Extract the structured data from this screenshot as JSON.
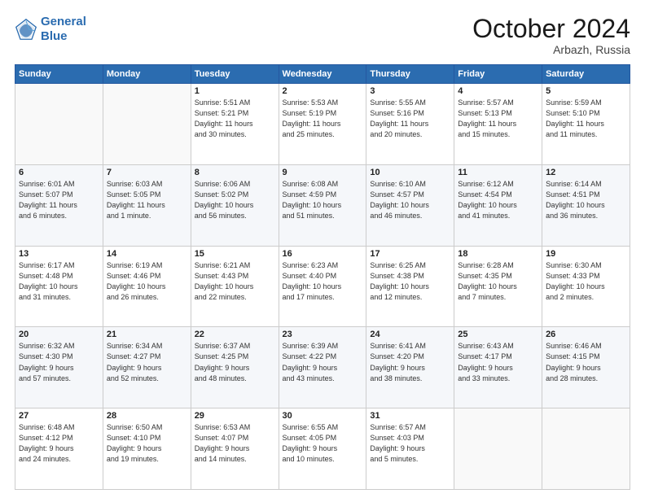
{
  "header": {
    "logo_line1": "General",
    "logo_line2": "Blue",
    "title": "October 2024",
    "subtitle": "Arbazh, Russia"
  },
  "days_of_week": [
    "Sunday",
    "Monday",
    "Tuesday",
    "Wednesday",
    "Thursday",
    "Friday",
    "Saturday"
  ],
  "weeks": [
    [
      {
        "day": "",
        "info": ""
      },
      {
        "day": "",
        "info": ""
      },
      {
        "day": "1",
        "info": "Sunrise: 5:51 AM\nSunset: 5:21 PM\nDaylight: 11 hours\nand 30 minutes."
      },
      {
        "day": "2",
        "info": "Sunrise: 5:53 AM\nSunset: 5:19 PM\nDaylight: 11 hours\nand 25 minutes."
      },
      {
        "day": "3",
        "info": "Sunrise: 5:55 AM\nSunset: 5:16 PM\nDaylight: 11 hours\nand 20 minutes."
      },
      {
        "day": "4",
        "info": "Sunrise: 5:57 AM\nSunset: 5:13 PM\nDaylight: 11 hours\nand 15 minutes."
      },
      {
        "day": "5",
        "info": "Sunrise: 5:59 AM\nSunset: 5:10 PM\nDaylight: 11 hours\nand 11 minutes."
      }
    ],
    [
      {
        "day": "6",
        "info": "Sunrise: 6:01 AM\nSunset: 5:07 PM\nDaylight: 11 hours\nand 6 minutes."
      },
      {
        "day": "7",
        "info": "Sunrise: 6:03 AM\nSunset: 5:05 PM\nDaylight: 11 hours\nand 1 minute."
      },
      {
        "day": "8",
        "info": "Sunrise: 6:06 AM\nSunset: 5:02 PM\nDaylight: 10 hours\nand 56 minutes."
      },
      {
        "day": "9",
        "info": "Sunrise: 6:08 AM\nSunset: 4:59 PM\nDaylight: 10 hours\nand 51 minutes."
      },
      {
        "day": "10",
        "info": "Sunrise: 6:10 AM\nSunset: 4:57 PM\nDaylight: 10 hours\nand 46 minutes."
      },
      {
        "day": "11",
        "info": "Sunrise: 6:12 AM\nSunset: 4:54 PM\nDaylight: 10 hours\nand 41 minutes."
      },
      {
        "day": "12",
        "info": "Sunrise: 6:14 AM\nSunset: 4:51 PM\nDaylight: 10 hours\nand 36 minutes."
      }
    ],
    [
      {
        "day": "13",
        "info": "Sunrise: 6:17 AM\nSunset: 4:48 PM\nDaylight: 10 hours\nand 31 minutes."
      },
      {
        "day": "14",
        "info": "Sunrise: 6:19 AM\nSunset: 4:46 PM\nDaylight: 10 hours\nand 26 minutes."
      },
      {
        "day": "15",
        "info": "Sunrise: 6:21 AM\nSunset: 4:43 PM\nDaylight: 10 hours\nand 22 minutes."
      },
      {
        "day": "16",
        "info": "Sunrise: 6:23 AM\nSunset: 4:40 PM\nDaylight: 10 hours\nand 17 minutes."
      },
      {
        "day": "17",
        "info": "Sunrise: 6:25 AM\nSunset: 4:38 PM\nDaylight: 10 hours\nand 12 minutes."
      },
      {
        "day": "18",
        "info": "Sunrise: 6:28 AM\nSunset: 4:35 PM\nDaylight: 10 hours\nand 7 minutes."
      },
      {
        "day": "19",
        "info": "Sunrise: 6:30 AM\nSunset: 4:33 PM\nDaylight: 10 hours\nand 2 minutes."
      }
    ],
    [
      {
        "day": "20",
        "info": "Sunrise: 6:32 AM\nSunset: 4:30 PM\nDaylight: 9 hours\nand 57 minutes."
      },
      {
        "day": "21",
        "info": "Sunrise: 6:34 AM\nSunset: 4:27 PM\nDaylight: 9 hours\nand 52 minutes."
      },
      {
        "day": "22",
        "info": "Sunrise: 6:37 AM\nSunset: 4:25 PM\nDaylight: 9 hours\nand 48 minutes."
      },
      {
        "day": "23",
        "info": "Sunrise: 6:39 AM\nSunset: 4:22 PM\nDaylight: 9 hours\nand 43 minutes."
      },
      {
        "day": "24",
        "info": "Sunrise: 6:41 AM\nSunset: 4:20 PM\nDaylight: 9 hours\nand 38 minutes."
      },
      {
        "day": "25",
        "info": "Sunrise: 6:43 AM\nSunset: 4:17 PM\nDaylight: 9 hours\nand 33 minutes."
      },
      {
        "day": "26",
        "info": "Sunrise: 6:46 AM\nSunset: 4:15 PM\nDaylight: 9 hours\nand 28 minutes."
      }
    ],
    [
      {
        "day": "27",
        "info": "Sunrise: 6:48 AM\nSunset: 4:12 PM\nDaylight: 9 hours\nand 24 minutes."
      },
      {
        "day": "28",
        "info": "Sunrise: 6:50 AM\nSunset: 4:10 PM\nDaylight: 9 hours\nand 19 minutes."
      },
      {
        "day": "29",
        "info": "Sunrise: 6:53 AM\nSunset: 4:07 PM\nDaylight: 9 hours\nand 14 minutes."
      },
      {
        "day": "30",
        "info": "Sunrise: 6:55 AM\nSunset: 4:05 PM\nDaylight: 9 hours\nand 10 minutes."
      },
      {
        "day": "31",
        "info": "Sunrise: 6:57 AM\nSunset: 4:03 PM\nDaylight: 9 hours\nand 5 minutes."
      },
      {
        "day": "",
        "info": ""
      },
      {
        "day": "",
        "info": ""
      }
    ]
  ]
}
